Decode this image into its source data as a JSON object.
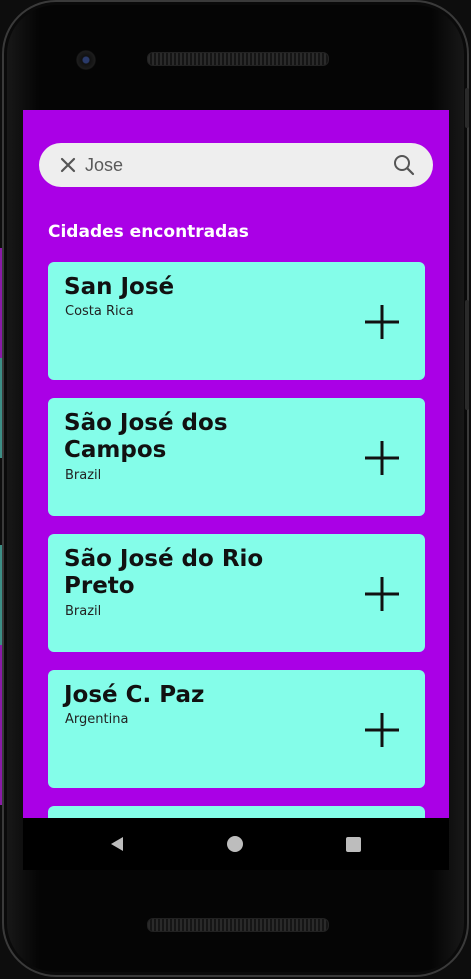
{
  "search": {
    "query": "Jose",
    "clear_icon": "close-icon",
    "search_icon": "search-icon"
  },
  "section_title": "Cidades encontradas",
  "cities": [
    {
      "name": "San José",
      "country": "Costa Rica"
    },
    {
      "name": "São José dos Campos",
      "country": "Brazil"
    },
    {
      "name": "São José do Rio Preto",
      "country": "Brazil"
    },
    {
      "name": "José C. Paz",
      "country": "Argentina"
    }
  ],
  "colors": {
    "screen_bg": "#aa00e6",
    "card_bg": "#84fde9",
    "search_bg": "#eeeeee"
  },
  "navbar": {
    "back_icon": "triangle-back-icon",
    "home_icon": "circle-home-icon",
    "recents_icon": "square-recents-icon"
  }
}
